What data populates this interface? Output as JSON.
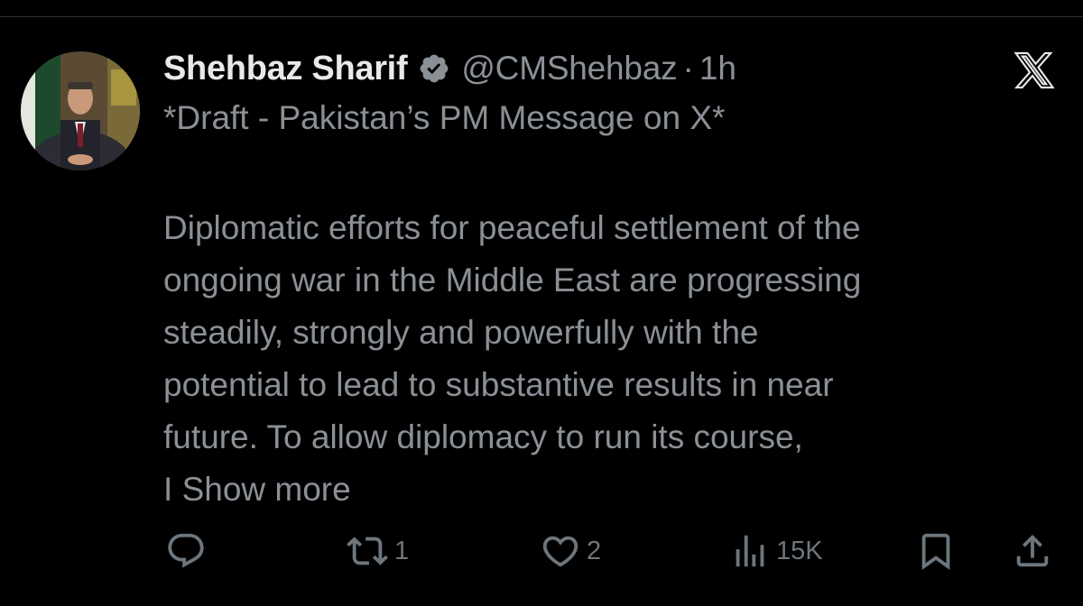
{
  "post": {
    "author": {
      "display_name": "Shehbaz Sharif",
      "handle": "@CMShehbaz",
      "verified": true,
      "verified_color": "#8b9096"
    },
    "separator": "·",
    "time": "1h",
    "draft_note": "*Draft - Pakistan’s PM Message on X*",
    "body_lines": [
      "Diplomatic efforts for peaceful settlement of the",
      "ongoing war in the Middle East are progressing",
      "steadily, strongly and powerfully with the",
      "potential to lead to substantive results in near",
      "future. To allow diplomacy to run its course,"
    ],
    "last_line_prefix": "I",
    "show_more_label": "Show more",
    "actions": {
      "reply": {
        "icon": "reply-icon",
        "count": ""
      },
      "repost": {
        "icon": "repost-icon",
        "count": "1"
      },
      "like": {
        "icon": "heart-icon",
        "count": "2"
      },
      "views": {
        "icon": "views-icon",
        "count": "15K"
      },
      "bookmark": {
        "icon": "bookmark-icon",
        "count": ""
      },
      "share": {
        "icon": "share-icon",
        "count": ""
      }
    }
  },
  "window": {
    "close_icon": "x-logo-icon"
  },
  "colors": {
    "background": "#000000",
    "primary_text": "#e7e9ea",
    "secondary_text": "#8b9096",
    "icon_gray": "#6e767d"
  }
}
